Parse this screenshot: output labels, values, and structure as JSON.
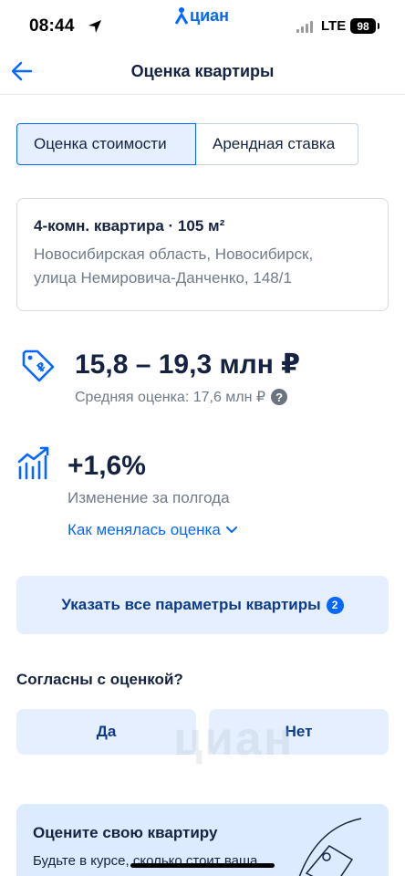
{
  "status_bar": {
    "time": "08:44",
    "network": "LTE",
    "battery": "98",
    "app_badge": "циан"
  },
  "nav": {
    "title": "Оценка квартиры"
  },
  "tabs": [
    {
      "label": "Оценка стоимости",
      "active": true
    },
    {
      "label": "Арендная ставка",
      "active": false
    }
  ],
  "property": {
    "title": "4-комн. квартира · 105 м²",
    "address_line1": "Новосибирская область, Новосибирск,",
    "address_line2": "улица Немировича-Данченко, 148/1"
  },
  "price": {
    "range": "15,8 – 19,3 млн ₽",
    "average": "Средняя оценка: 17,6 млн ₽",
    "help": "?"
  },
  "change": {
    "value": "+1,6%",
    "label": "Изменение за полгода",
    "link": "Как менялась оценка"
  },
  "params_button": {
    "label": "Указать все параметры квартиры",
    "badge": "2"
  },
  "agree": {
    "question": "Согласны с оценкой?",
    "yes": "Да",
    "no": "Нет"
  },
  "watermark": "циан",
  "promo": {
    "title": "Оцените свою квартиру",
    "text": "Будьте в курсе, сколько стоит ваша"
  },
  "colors": {
    "accent": "#0468ff",
    "text_primary": "#152242",
    "text_secondary": "#707a89",
    "light_blue": "#e5efff"
  }
}
